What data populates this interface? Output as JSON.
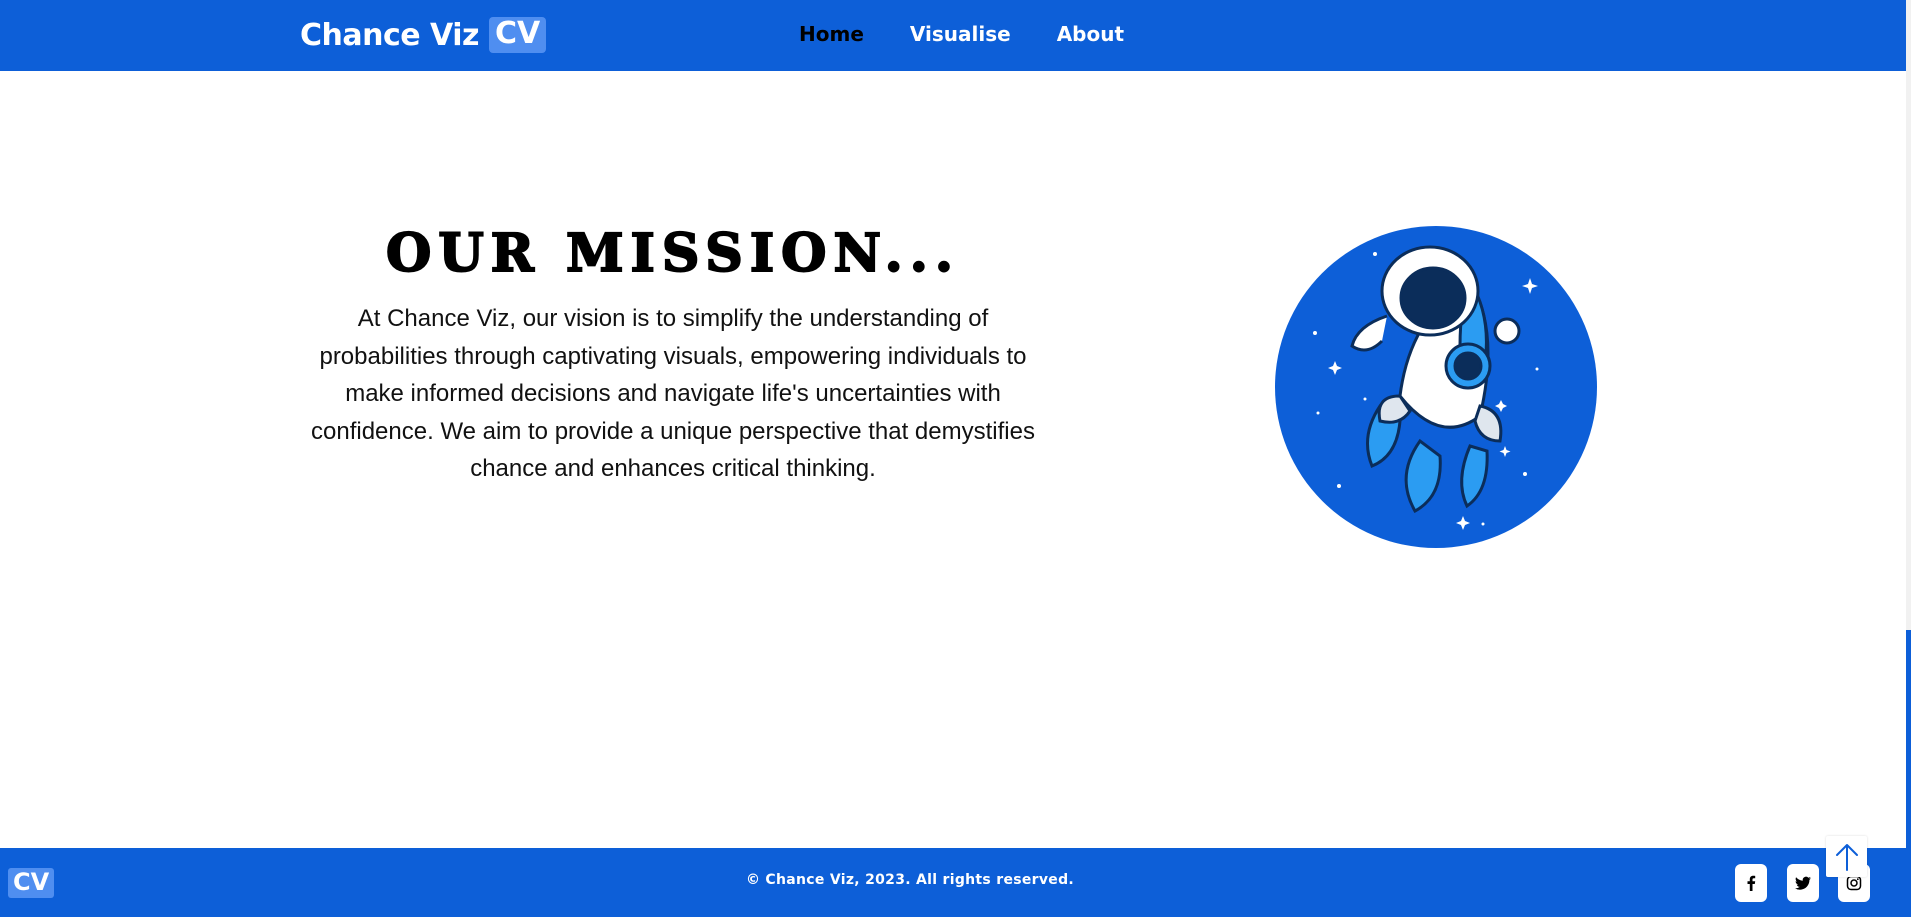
{
  "header": {
    "brand_name": "Chance Viz",
    "brand_badge": "CV",
    "nav": [
      {
        "label": "Home",
        "active": true
      },
      {
        "label": "Visualise",
        "active": false
      },
      {
        "label": "About",
        "active": false
      }
    ]
  },
  "main": {
    "title": "OUR MISSION...",
    "text": "At Chance Viz, our vision is to simplify the understanding of probabilities through captivating visuals, empowering individuals to make informed decisions and navigate life's uncertainties with confidence. We aim to provide a unique perspective that demystifies chance and enhances critical thinking.",
    "illustration": "astronaut-riding-rocket"
  },
  "footer": {
    "logo": "CV",
    "copyright": "© Chance Viz, 2023. All rights reserved.",
    "social": [
      "facebook-icon",
      "twitter-icon",
      "instagram-icon"
    ]
  },
  "colors": {
    "primary": "#0d5fd8",
    "badge": "#4f8ef0",
    "active_nav": "#000000"
  }
}
